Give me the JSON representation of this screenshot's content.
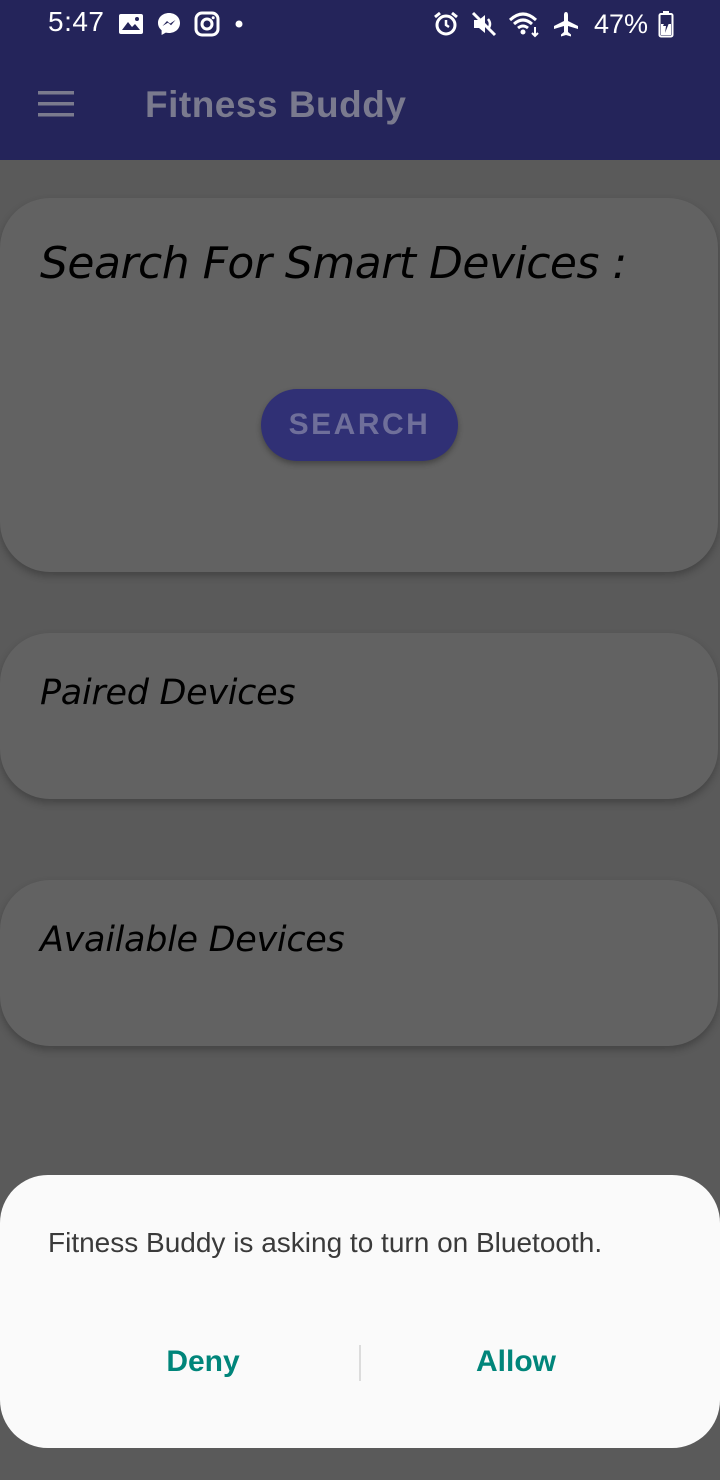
{
  "status_bar": {
    "time": "5:47",
    "battery": "47%",
    "left_icons": [
      "image-icon",
      "messenger-icon",
      "instagram-icon",
      "dot-icon"
    ],
    "right_icons": [
      "alarm-icon",
      "mute-icon",
      "wifi-icon",
      "airplane-icon",
      "battery-charging-icon"
    ]
  },
  "app_bar": {
    "title": "Fitness Buddy",
    "menu_icon": "hamburger-menu-icon"
  },
  "search_card": {
    "title": "Search For Smart Devices :",
    "button_label": "SEARCH"
  },
  "paired_card": {
    "title": "Paired Devices"
  },
  "available_card": {
    "title": "Available Devices"
  },
  "dialog": {
    "message": "Fitness Buddy is asking to turn on Bluetooth.",
    "deny_label": "Deny",
    "allow_label": "Allow"
  },
  "colors": {
    "app_bar": "#24245a",
    "overlay_background": "#5a5a5a",
    "dialog_button": "#00857a"
  }
}
